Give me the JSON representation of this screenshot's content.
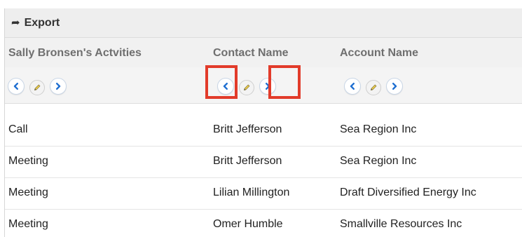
{
  "top_strip_text": "",
  "toolbar": {
    "export_icon": "arrow-right-icon",
    "export_label": "Export"
  },
  "columns": [
    {
      "label": "Sally Bronsen's Actvities"
    },
    {
      "label": "Contact Name"
    },
    {
      "label": "Account Name"
    }
  ],
  "column_controls": {
    "icons": [
      "chevron-left-icon",
      "pencil-icon",
      "chevron-right-icon"
    ]
  },
  "rows": [
    {
      "activity": "Call",
      "contact": "Britt Jefferson",
      "account": "Sea Region Inc"
    },
    {
      "activity": "Meeting",
      "contact": "Britt Jefferson",
      "account": "Sea Region Inc"
    },
    {
      "activity": "Meeting",
      "contact": "Lilian Millington",
      "account": "Draft Diversified Energy Inc"
    },
    {
      "activity": "Meeting",
      "contact": "Omer Humble",
      "account": "Smallville Resources Inc"
    }
  ],
  "colors": {
    "highlight": "#e23b2a",
    "nav_arrow": "#1f6fd1",
    "header_text": "#6f6f6f"
  }
}
